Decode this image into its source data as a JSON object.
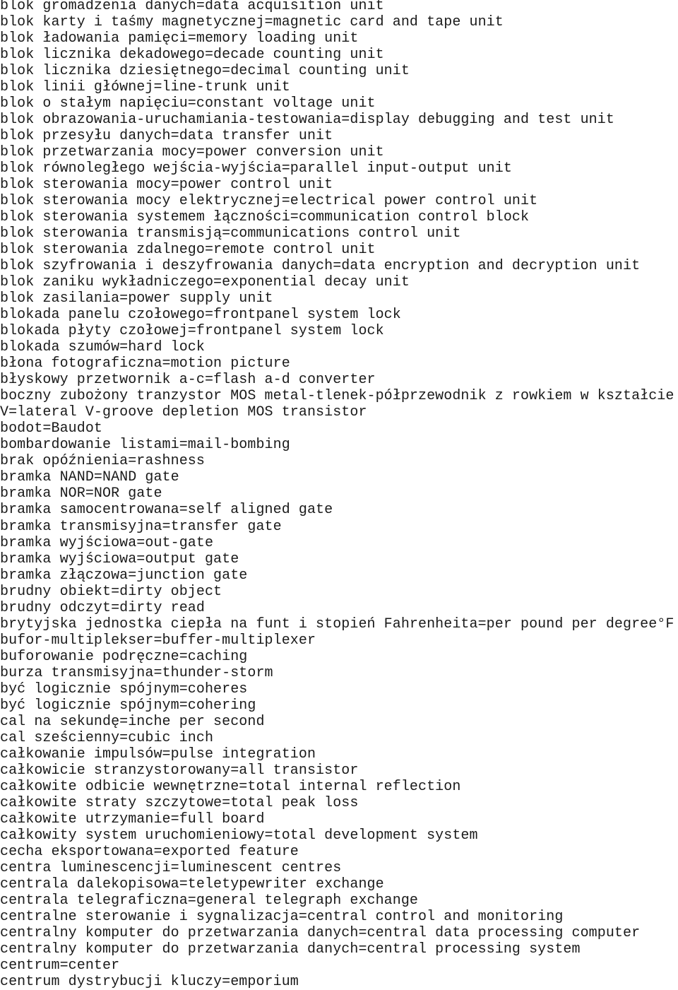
{
  "document": {
    "lines": [
      "blok gromadzenia danych=data acquisition unit",
      "blok karty i taśmy magnetycznej=magnetic card and tape unit",
      "blok ładowania pamięci=memory loading unit",
      "blok licznika dekadowego=decade counting unit",
      "blok licznika dziesiętnego=decimal counting unit",
      "blok linii głównej=line-trunk unit",
      "blok o stałym napięciu=constant voltage unit",
      "blok obrazowania-uruchamiania-testowania=display debugging and test unit",
      "blok przesyłu danych=data transfer unit",
      "blok przetwarzania mocy=power conversion unit",
      "blok równoległego wejścia-wyjścia=parallel input-output unit",
      "blok sterowania mocy=power control unit",
      "blok sterowania mocy elektrycznej=electrical power control unit",
      "blok sterowania systemem łączności=communication control block",
      "blok sterowania transmisją=communications control unit",
      "blok sterowania zdalnego=remote control unit",
      "blok szyfrowania i deszyfrowania danych=data encryption and decryption unit",
      "blok zaniku wykładniczego=exponential decay unit",
      "blok zasilania=power supply unit",
      "blokada panelu czołowego=frontpanel system lock",
      "blokada płyty czołowej=frontpanel system lock",
      "blokada szumów=hard lock",
      "błona fotograficzna=motion picture",
      "błyskowy przetwornik a-c=flash a-d converter",
      "boczny zubożony tranzystor MOS metal-tlenek-półprzewodnik z rowkiem w kształcie",
      "V=lateral V-groove depletion MOS transistor",
      "bodot=Baudot",
      "bombardowanie listami=mail-bombing",
      "brak opóźnienia=rashness",
      "bramka NAND=NAND gate",
      "bramka NOR=NOR gate",
      "bramka samocentrowana=self aligned gate",
      "bramka transmisyjna=transfer gate",
      "bramka wyjściowa=out-gate",
      "bramka wyjściowa=output gate",
      "bramka złączowa=junction gate",
      "brudny obiekt=dirty object",
      "brudny odczyt=dirty read",
      "brytyjska jednostka ciepła na funt i stopień Fahrenheita=per pound per degree°F",
      "bufor-multiplekser=buffer-multiplexer",
      "buforowanie podręczne=caching",
      "burza transmisyjna=thunder-storm",
      "być logicznie spójnym=coheres",
      "być logicznie spójnym=cohering",
      "cal na sekundę=inche per second",
      "cal sześcienny=cubic inch",
      "całkowanie impulsów=pulse integration",
      "całkowicie stranzystorowany=all transistor",
      "całkowite odbicie wewnętrzne=total internal reflection",
      "całkowite straty szczytowe=total peak loss",
      "całkowite utrzymanie=full board",
      "całkowity system uruchomieniowy=total development system",
      "cecha eksportowana=exported feature",
      "centra luminescencji=luminescent centres",
      "centrala dalekopisowa=teletypewriter exchange",
      "centrala telegraficzna=general telegraph exchange",
      "centralne sterowanie i sygnalizacja=central control and monitoring",
      "centralny komputer do przetwarzania danych=central data processing computer",
      "centralny komputer do przetwarzania danych=central processing system",
      "centrum=center",
      "centrum dystrybucji kluczy=emporium"
    ]
  }
}
